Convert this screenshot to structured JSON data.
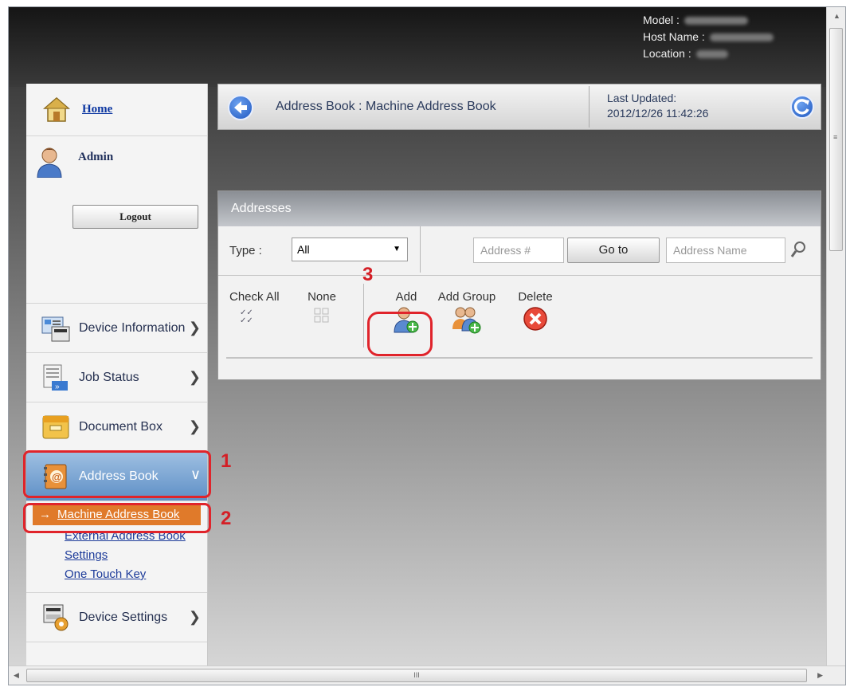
{
  "device_info": {
    "model_label": "Model :",
    "host_label": "Host Name :",
    "location_label": "Location :"
  },
  "sidebar": {
    "home_label": "Home",
    "admin_label": "Admin",
    "logout_label": "Logout",
    "items": [
      {
        "label": "Device Information",
        "icon": "device-information-icon"
      },
      {
        "label": "Job Status",
        "icon": "job-status-icon"
      },
      {
        "label": "Document Box",
        "icon": "document-box-icon"
      },
      {
        "label": "Address Book",
        "icon": "address-book-icon",
        "active": true
      },
      {
        "label": "Device Settings",
        "icon": "device-settings-icon"
      }
    ],
    "submenu": {
      "active": "Machine Address Book",
      "external_line1": "External Address Book",
      "external_line2": "Settings",
      "one_touch": "One Touch Key"
    }
  },
  "header": {
    "title": "Address Book : Machine Address Book",
    "updated_label": "Last Updated:",
    "updated_value": "2012/12/26 11:42:26"
  },
  "panel": {
    "title": "Addresses",
    "type_label": "Type :",
    "type_value": "All",
    "address_placeholder": "Address #",
    "goto_label": "Go to",
    "name_placeholder": "Address Name",
    "actions": {
      "check_all": "Check All",
      "none": "None",
      "add": "Add",
      "add_group": "Add Group",
      "delete": "Delete"
    }
  },
  "annotations": {
    "step1": "1",
    "step2": "2",
    "step3": "3",
    "highlight_color": "#e0242b"
  },
  "scrollbar": {
    "grip": "III"
  }
}
